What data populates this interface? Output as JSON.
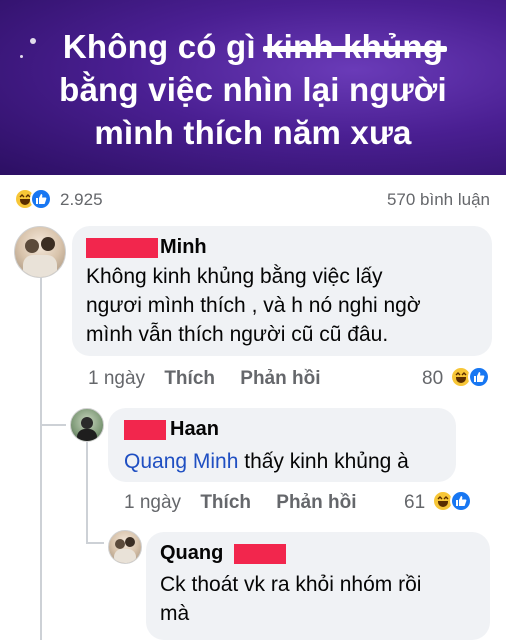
{
  "banner": {
    "line1_prefix": "Không có gì ",
    "line1_struck": "kinh khủng",
    "line2": "bằng việc nhìn lại người",
    "line3": "mình thích năm xưa"
  },
  "post_stats": {
    "reactions_count": "2.925",
    "comments_count": "570 bình luận"
  },
  "comments": [
    {
      "name": "Minh",
      "text_lines": [
        "Không kinh khủng bằng việc lấy",
        "ngươi mình thích , và h nó nghi ngờ",
        "mình vẫn thích người cũ cũ đâu."
      ],
      "time": "1 ngày",
      "like_label": "Thích",
      "reply_label": "Phản hồi",
      "reaction_count": "80"
    },
    {
      "name": "Haan",
      "mention": "Quang Minh",
      "text": " thấy kinh khủng à",
      "time": "1 ngày",
      "like_label": "Thích",
      "reply_label": "Phản hồi",
      "reaction_count": "61"
    },
    {
      "name": "Quang",
      "text_lines": [
        "Ck thoát vk ra khỏi nhóm rồi",
        "mà"
      ]
    }
  ],
  "colors": {
    "redaction": "#f2264d",
    "banner_purple": "#4a1f92",
    "link_blue": "#1f4fc2",
    "bubble_gray": "#f0f2f5"
  }
}
